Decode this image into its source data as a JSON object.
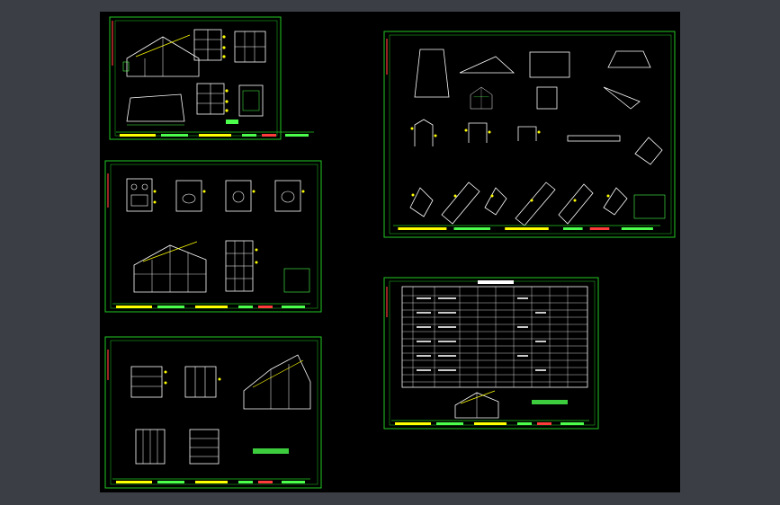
{
  "window": {
    "background_color": "#3b3e44",
    "viewport_color": "#000000"
  },
  "colors": {
    "frame": "#22c922",
    "lines": "#ffffff",
    "dims": "#4cff4c",
    "marks": "#ffff00",
    "accent": "#ff3b3b",
    "label": "#39d2ff"
  },
  "sheets": [
    {
      "id": "sheet-1",
      "kind": "elevations-and-plans"
    },
    {
      "id": "sheet-2",
      "kind": "sections-and-elevation"
    },
    {
      "id": "sheet-3",
      "kind": "panel-details"
    },
    {
      "id": "sheet-4",
      "kind": "component-details"
    },
    {
      "id": "sheet-5",
      "kind": "material-schedule-table"
    }
  ],
  "icons": {
    "frame_corner": "corner-marker-icon"
  }
}
